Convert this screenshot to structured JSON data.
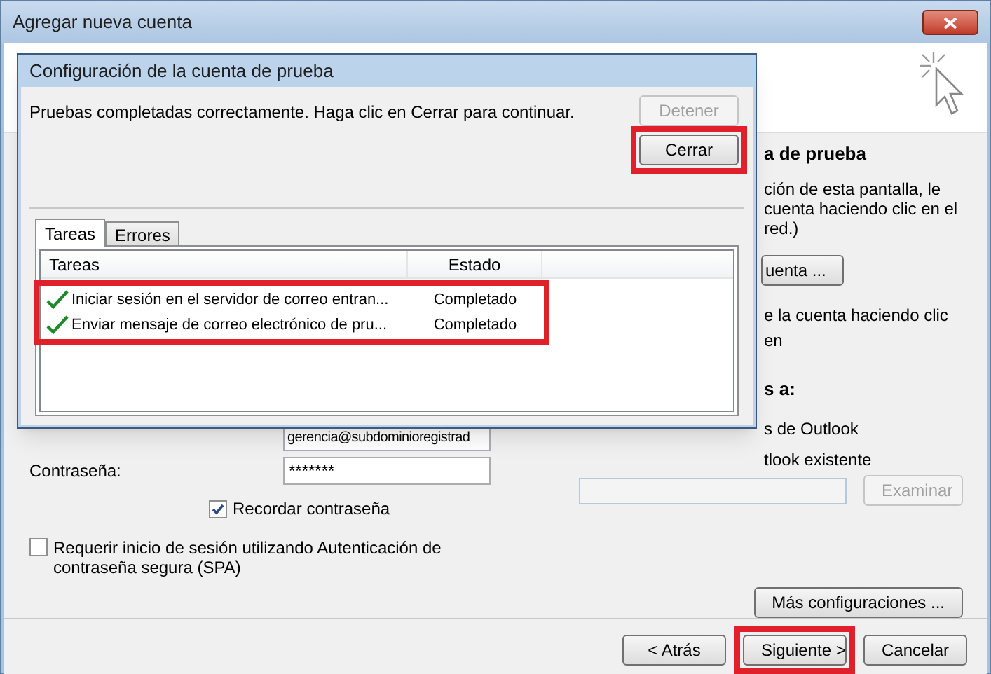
{
  "window": {
    "title": "Agregar nueva cuenta"
  },
  "right_panel": {
    "heading_1": "a de prueba",
    "paragraph_lines": [
      "ción de esta pantalla, le",
      "cuenta haciendo clic en el",
      "red.)"
    ],
    "button": "uenta ...",
    "line": "e la cuenta haciendo clic en",
    "heading_2": "s a:",
    "options": [
      "s de Outlook",
      "tlook existente"
    ],
    "browse_button": {
      "label": "Examinar",
      "disabled": true
    },
    "more_settings_button": "Más configuraciones ..."
  },
  "left_panel": {
    "email_value": "gerencia@subdominioregistrad",
    "password_label": "Contraseña:",
    "password_value": "*******",
    "remember_password": {
      "label": "Recordar contraseña",
      "checked": true
    },
    "spa": {
      "label": "Requerir inicio de sesión utilizando Autenticación de contraseña segura (SPA)",
      "checked": false
    }
  },
  "footer_buttons": [
    {
      "label": "< Atrás",
      "highlighted": false
    },
    {
      "label": "Siguiente >",
      "highlighted": true
    },
    {
      "label": "Cancelar",
      "highlighted": false
    }
  ],
  "dialog": {
    "title": "Configuración de la cuenta de prueba",
    "message": "Pruebas completadas correctamente. Haga clic en Cerrar para continuar.",
    "stop_button": {
      "label": "Detener",
      "disabled": true
    },
    "close_button": {
      "label": "Cerrar",
      "highlighted": true
    },
    "tabs": [
      {
        "label": "Tareas",
        "selected": true
      },
      {
        "label": "Errores",
        "selected": false
      }
    ],
    "table": {
      "columns": [
        "Tareas",
        "Estado"
      ],
      "highlighted": true,
      "rows": [
        {
          "task": "Iniciar sesión en el servidor de correo entran...",
          "status": "Completado",
          "done": true
        },
        {
          "task": "Enviar mensaje de correo electrónico de pru...",
          "status": "Completado",
          "done": true
        }
      ]
    }
  }
}
